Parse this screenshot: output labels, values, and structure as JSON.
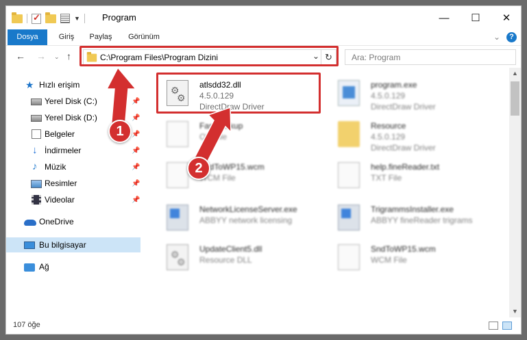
{
  "window": {
    "title": "Program",
    "controls": {
      "minimize": "—",
      "maximize": "☐",
      "close": "✕"
    }
  },
  "ribbon": {
    "tabs": [
      "Dosya",
      "Giriş",
      "Paylaş",
      "Görünüm"
    ],
    "help": "?"
  },
  "navigation": {
    "address": "C:\\Program Files\\Program Dizini",
    "search_placeholder": "Ara: Program"
  },
  "sidebar": {
    "items": [
      {
        "label": "Hızlı erişim",
        "icon": "star-icon"
      },
      {
        "label": "Yerel Disk (C:)",
        "icon": "disk-icon",
        "pinned": true
      },
      {
        "label": "Yerel Disk (D:)",
        "icon": "disk-icon",
        "pinned": true
      },
      {
        "label": "Belgeler",
        "icon": "documents-icon",
        "pinned": true
      },
      {
        "label": "İndirmeler",
        "icon": "downloads-icon",
        "pinned": true
      },
      {
        "label": "Müzik",
        "icon": "music-icon",
        "pinned": true
      },
      {
        "label": "Resimler",
        "icon": "pictures-icon",
        "pinned": true
      },
      {
        "label": "Videolar",
        "icon": "videos-icon",
        "pinned": true
      },
      {
        "label": "OneDrive",
        "icon": "onedrive-icon"
      },
      {
        "label": "Bu bilgisayar",
        "icon": "this-pc-icon",
        "selected": true
      },
      {
        "label": "Ağ",
        "icon": "network-icon"
      }
    ]
  },
  "files": [
    {
      "name": "atlsdd32.dll",
      "version": "4.5.0.129",
      "description": "DirectDraw Driver",
      "type": "dll",
      "blurred": false
    },
    {
      "name": "program.exe",
      "version": "4.5.0.129",
      "description": "DirectDraw Driver",
      "type": "exe",
      "blurred": true
    },
    {
      "name": "FastBackup",
      "version": "OK File",
      "description": "",
      "type": "doc",
      "blurred": true
    },
    {
      "name": "Resource",
      "version": "4.5.0.129",
      "description": "DirectDraw Driver",
      "type": "folder",
      "blurred": true
    },
    {
      "name": "SndToWP15.wcm",
      "version": "WCM File",
      "description": "",
      "type": "doc",
      "blurred": true
    },
    {
      "name": "help.fineReader.txt",
      "version": "TXT File",
      "description": "",
      "type": "doc",
      "blurred": true
    },
    {
      "name": "NetworkLicenseServer.exe",
      "version": "ABBYY network licensing",
      "description": "",
      "type": "app",
      "blurred": true
    },
    {
      "name": "TrigrammsInstaller.exe",
      "version": "ABBYY fineReader trigrams",
      "description": "",
      "type": "app",
      "blurred": true
    },
    {
      "name": "UpdateClient5.dll",
      "version": "Resource DLL",
      "description": "",
      "type": "dll",
      "blurred": true
    },
    {
      "name": "SndToWP15.wcm",
      "version": "WCM File",
      "description": "",
      "type": "doc",
      "blurred": true
    }
  ],
  "status": {
    "count_text": "107 öğe"
  },
  "annotations": {
    "badge1": "1",
    "badge2": "2",
    "color": "#d32f2f"
  }
}
